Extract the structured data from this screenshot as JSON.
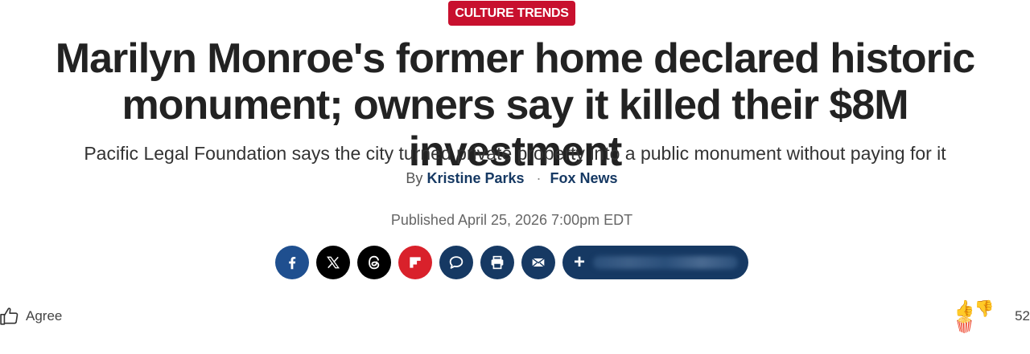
{
  "article": {
    "category": "CULTURE TRENDS",
    "headline": "Marilyn Monroe's former home declared historic monument; owners say it killed their $8M investment",
    "subheadline": "Pacific Legal Foundation says the city turned private property into a public monument without paying for it",
    "byline_prefix": "By",
    "author": "Kristine Parks",
    "separator": "·",
    "outlet": "Fox News",
    "published": "Published April 25, 2026 7:00pm EDT"
  },
  "share": {
    "buttons": [
      {
        "name": "facebook",
        "icon": "facebook-icon",
        "color": "#1f4f8f"
      },
      {
        "name": "x",
        "icon": "x-icon",
        "color": "#000000"
      },
      {
        "name": "threads",
        "icon": "threads-icon",
        "color": "#000000"
      },
      {
        "name": "flipboard",
        "icon": "flipboard-icon",
        "color": "#d9212b"
      },
      {
        "name": "comments",
        "icon": "comment-icon",
        "color": "#163963"
      },
      {
        "name": "print",
        "icon": "print-icon",
        "color": "#163963"
      },
      {
        "name": "email",
        "icon": "email-icon",
        "color": "#163963"
      }
    ],
    "more_symbol": "+"
  },
  "footer": {
    "agree_label": "Agree",
    "reaction_emojis": "👍👎🍿",
    "reaction_count": "52"
  },
  "colors": {
    "category_bg": "#c8102e",
    "brand_navy": "#163963"
  }
}
